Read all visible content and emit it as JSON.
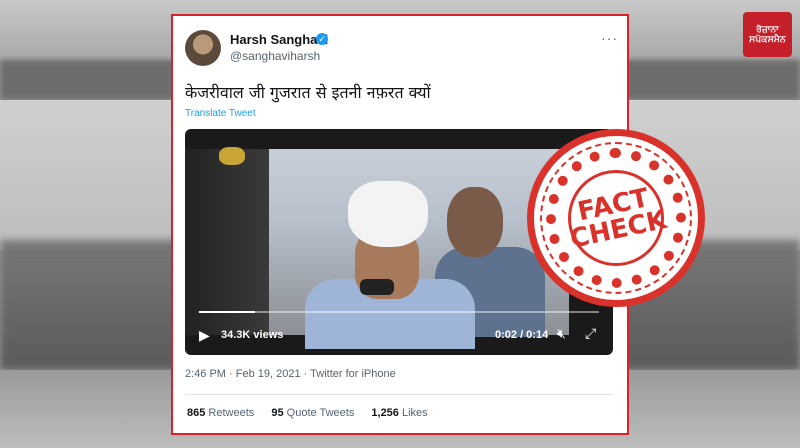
{
  "logo": {
    "line1": "ਰੋਜ਼ਾਨਾ",
    "line2": "ਸਪੋਕਸਮੈਨ"
  },
  "tweet": {
    "author_name": "Harsh Sanghavi",
    "handle": "@sanghaviharsh",
    "text": "केजरीवाल जी गुजरात से इतनी नफ़रत क्यों",
    "translate_label": "Translate Tweet",
    "video": {
      "views": "34.3K views",
      "time": "0:02 / 0:14",
      "progress_fraction": 0.14
    },
    "timestamp": "2:46 PM · Feb 19, 2021 · Twitter for iPhone",
    "stats": [
      {
        "count": "865",
        "label": "Retweets"
      },
      {
        "count": "95",
        "label": "Quote Tweets"
      },
      {
        "count": "1,256",
        "label": "Likes"
      }
    ]
  },
  "stamp": {
    "line1": "FACT",
    "line2": "CHECK"
  },
  "colors": {
    "accent_red": "#d8232a",
    "twitter_blue": "#1d9bf0"
  },
  "icons": [
    "verified-icon",
    "more-icon",
    "play-icon",
    "mute-icon",
    "expand-icon"
  ]
}
